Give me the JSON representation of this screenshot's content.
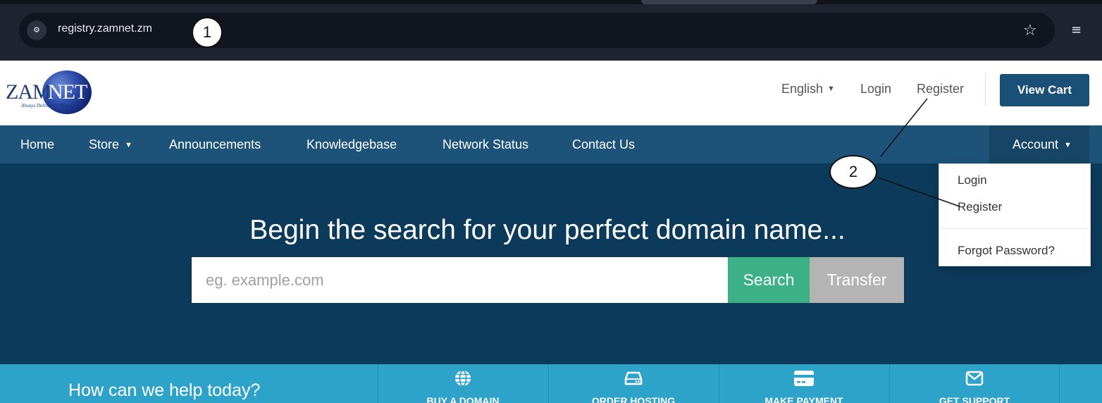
{
  "browser": {
    "url": "registry.zamnet.zm",
    "site_info_glyph": "⚙",
    "bookmark_glyph": "☆",
    "reading_list_glyph": "≡"
  },
  "annotations": {
    "one": "1",
    "two": "2"
  },
  "logo": {
    "left": "ZAM",
    "right": "NET",
    "tagline": "Always Delivers IT Better"
  },
  "header": {
    "language": "English",
    "login": "Login",
    "register": "Register",
    "view_cart": "View Cart"
  },
  "nav": {
    "home": "Home",
    "store": "Store",
    "announcements": "Announcements",
    "knowledgebase": "Knowledgebase",
    "network_status": "Network Status",
    "contact_us": "Contact Us",
    "account": "Account"
  },
  "dropdown": {
    "login": "Login",
    "register": "Register",
    "forgot_password": "Forgot Password?"
  },
  "hero": {
    "title": "Begin the search for your perfect domain name...",
    "search_placeholder": "eg. example.com",
    "search_label": "Search",
    "transfer_label": "Transfer"
  },
  "help": {
    "title": "How can we help today?",
    "buy_domain": "BUY A DOMAIN",
    "order_hosting": "ORDER HOSTING",
    "make_payment": "MAKE PAYMENT",
    "get_support": "GET SUPPORT"
  },
  "colors": {
    "nav_bg": "#1e5379",
    "hero_bg": "#0c3a5b",
    "search_green": "#3cb087",
    "help_blue": "#2ea3c9",
    "cart_blue": "#1a5077"
  }
}
